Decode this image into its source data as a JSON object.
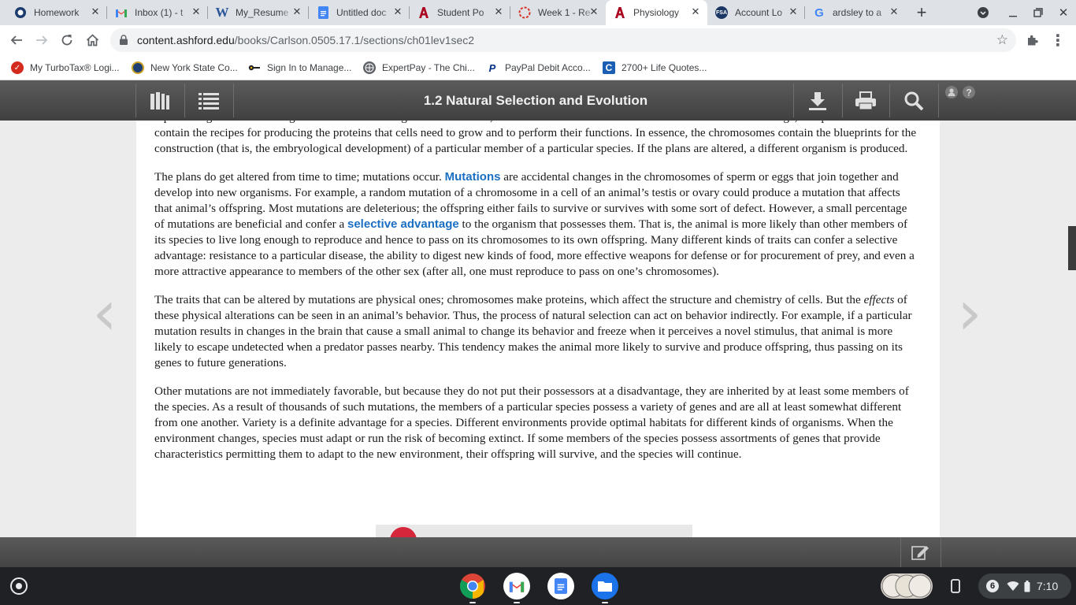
{
  "tabs": [
    {
      "title": "Homework",
      "icon": "ashford-icon",
      "active": false
    },
    {
      "title": "Inbox (1) - t",
      "icon": "gmail-icon",
      "active": false
    },
    {
      "title": "My_Resume",
      "icon": "word-icon",
      "active": false
    },
    {
      "title": "Untitled doc",
      "icon": "docs-icon",
      "active": false
    },
    {
      "title": "Student Po",
      "icon": "university-icon",
      "active": false
    },
    {
      "title": "Week 1 - Re",
      "icon": "loading-icon",
      "active": false
    },
    {
      "title": "Physiology",
      "icon": "university-icon",
      "active": true
    },
    {
      "title": "Account Lo",
      "icon": "fsa-icon",
      "active": false
    },
    {
      "title": "ardsley to a",
      "icon": "google-icon",
      "active": false
    }
  ],
  "omnibox": {
    "domain": "content.ashford.edu",
    "path": "/books/Carlson.0505.17.1/sections/ch01lev1sec2"
  },
  "bookmarks": [
    {
      "label": "My TurboTax® Logi...",
      "icon": "turbotax-icon",
      "color": "#d52b1e"
    },
    {
      "label": "New York State Co...",
      "icon": "nys-seal-icon",
      "color": "#1e3f73"
    },
    {
      "label": "Sign In to Manage...",
      "icon": "key-icon",
      "color": "#202124"
    },
    {
      "label": "ExpertPay - The Chi...",
      "icon": "globe-icon",
      "color": "#5f6368"
    },
    {
      "label": "PayPal Debit Acco...",
      "icon": "paypal-icon",
      "color": "#003087"
    },
    {
      "label": "2700+ Life Quotes...",
      "icon": "c-icon",
      "color": "#1a5fb4"
    }
  ],
  "reader": {
    "title": "1.2 Natural Selection and Evolution"
  },
  "content": {
    "p0": "reproducing multicellular organism consists of a large number of cells, each of which contains chromosomes. Chromosomes are large, complex molecules that contain the recipes for producing the proteins that cells need to grow and to perform their functions. In essence, the chromosomes contain the blueprints for the construction (that is, the embryological development) of a particular member of a particular species. If the plans are altered, a different organism is produced.",
    "p1_a": "The plans do get altered from time to time; mutations occur. ",
    "p1_kw1": "Mutations",
    "p1_b": " are accidental changes in the chromosomes of sperm or eggs that join together and develop into new organisms. For example, a random mutation of a chromosome in a cell of an animal’s testis or ovary could produce a mutation that affects that animal’s offspring. Most mutations are deleterious; the offspring either fails to survive or survives with some sort of defect. However, a small percentage of mutations are beneficial and confer a ",
    "p1_kw2": "selective advantage",
    "p1_c": " to the organism that possesses them. That is, the animal is more likely than other members of its species to live long enough to reproduce and hence to pass on its chromosomes to its own offspring. Many different kinds of traits can confer a selective advantage: resistance to a particular disease, the ability to digest new kinds of food, more effective weapons for defense or for procurement of prey, and even a more attractive appearance to members of the other sex (after all, one must reproduce to pass on one’s chromosomes).",
    "p2_a": "The traits that can be altered by mutations are physical ones; chromosomes make proteins, which affect the structure and chemistry of cells. But the ",
    "p2_em": "effects",
    "p2_b": " of these physical alterations can be seen in an animal’s behavior. Thus, the process of natural selection can act on behavior indirectly. For example, if a particular mutation results in changes in the brain that cause a small animal to change its behavior and freeze when it perceives a novel stimulus, that animal is more likely to escape undetected when a predator passes nearby. This tendency makes the animal more likely to survive and produce offspring, thus passing on its genes to future generations.",
    "p3": "Other mutations are not immediately favorable, but because they do not put their possessors at a disadvantage, they are inherited by at least some members of the species. As a result of thousands of such mutations, the members of a particular species possess a variety of genes and are all at least somewhat different from one another. Variety is a definite advantage for a species. Different environments provide optimal habitats for different kinds of organisms. When the environment changes, species must adapt or run the risk of becoming extinct. If some members of the species possess assortments of genes that provide characteristics permitting them to adapt to the new environment, their offspring will survive, and the species will continue."
  },
  "shelf": {
    "apps": [
      "chrome-icon",
      "gmail-icon",
      "docs-icon",
      "files-icon"
    ],
    "notification_count": "6",
    "time": "7:10"
  },
  "colors": {
    "keyword": "#1a6fc2",
    "reader_bar": "#4a4a4a",
    "shelf": "#202124"
  }
}
